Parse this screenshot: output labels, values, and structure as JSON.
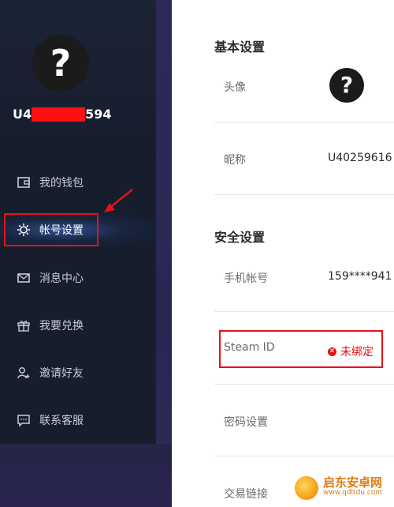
{
  "user": {
    "avatar_glyph": "?",
    "id_prefix": "U4",
    "id_suffix": "594"
  },
  "sidebar": {
    "items": [
      {
        "label": "我的钱包",
        "icon": "wallet-icon"
      },
      {
        "label": "帐号设置",
        "icon": "gear-icon"
      },
      {
        "label": "消息中心",
        "icon": "mail-icon"
      },
      {
        "label": "我要兑换",
        "icon": "gift-icon"
      },
      {
        "label": "邀请好友",
        "icon": "add-user-icon"
      },
      {
        "label": "联系客服",
        "icon": "chat-icon"
      }
    ],
    "active_index": 1
  },
  "basic": {
    "title": "基本设置",
    "avatar_label": "头像",
    "avatar_glyph": "?",
    "nickname_label": "昵称",
    "nickname_value": "U40259616"
  },
  "security": {
    "title": "安全设置",
    "phone_label": "手机帐号",
    "phone_value": "159****941",
    "steam_label": "Steam ID",
    "steam_status": "未绑定",
    "password_label": "密码设置",
    "trade_label": "交易链接"
  },
  "watermark": {
    "title": "启东安卓网",
    "url": "www.qdltdu.com"
  },
  "colors": {
    "sidebar_bg": "#161e2e",
    "accent_red": "#e8101a",
    "active_glow": "#4678dc"
  }
}
